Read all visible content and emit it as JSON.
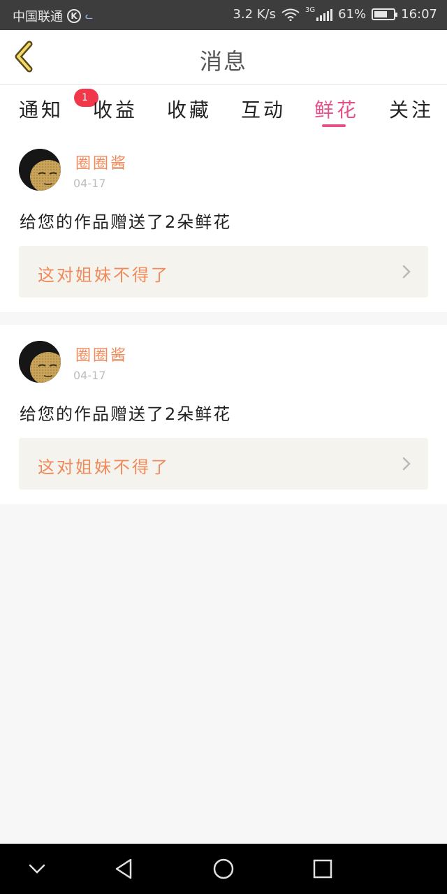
{
  "status_bar": {
    "carrier": "中国联通",
    "k_icon_label": "K",
    "speed": "3.2 K/s",
    "network": "3G",
    "battery": "61%",
    "time": "16:07"
  },
  "header": {
    "title": "消息"
  },
  "tabs": [
    {
      "label": "通知",
      "badge": "1"
    },
    {
      "label": "收益"
    },
    {
      "label": "收藏"
    },
    {
      "label": "互动"
    },
    {
      "label": "鲜花",
      "active": true
    },
    {
      "label": "关注"
    }
  ],
  "messages": [
    {
      "username": "圈圈酱",
      "date": "04-17",
      "text": "给您的作品赠送了2朵鲜花",
      "quote": "这对姐妹不得了"
    },
    {
      "username": "圈圈酱",
      "date": "04-17",
      "text": "给您的作品赠送了2朵鲜花",
      "quote": "这对姐妹不得了"
    }
  ],
  "colors": {
    "accent": "#e6508a",
    "username": "#f08a5a",
    "badge": "#f0384a",
    "quote_bg": "#f4f3ee"
  }
}
